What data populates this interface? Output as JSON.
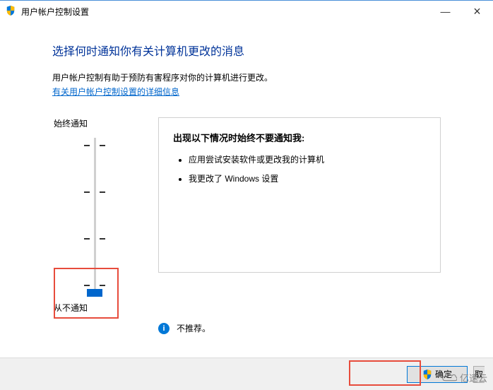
{
  "window": {
    "title": "用户帐户控制设置",
    "minimize": "—",
    "close": "×"
  },
  "main": {
    "heading": "选择何时通知你有关计算机更改的消息",
    "description": "用户帐户控制有助于预防有害程序对你的计算机进行更改。",
    "link": "有关用户帐户控制设置的详细信息",
    "slider_top": "始终通知",
    "slider_bottom": "从不通知",
    "panel_title": "出现以下情况时始终不要通知我:",
    "bullets": [
      "应用尝试安装软件或更改我的计算机",
      "我更改了 Windows 设置"
    ],
    "recommend": "不推荐。"
  },
  "footer": {
    "ok": "确定",
    "cancel_partial": "取"
  },
  "watermark": "亿速云"
}
